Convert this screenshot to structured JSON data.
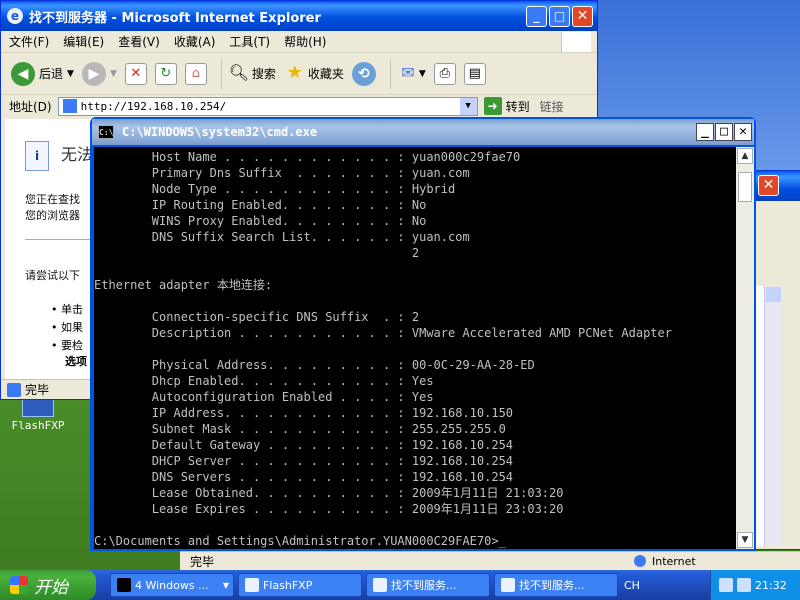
{
  "desktop": {
    "icon_label": "FlashFXP"
  },
  "ie": {
    "title": "找不到服务器 - Microsoft Internet Explorer",
    "menu": [
      "文件(F)",
      "编辑(E)",
      "查看(V)",
      "收藏(A)",
      "工具(T)",
      "帮助(H)"
    ],
    "toolbar": {
      "back": "后退",
      "search": "搜索",
      "favorites": "收藏夹"
    },
    "address_label": "地址(D)",
    "address_value": "http://192.168.10.254/",
    "go_label": "转到",
    "links_label": "链接",
    "page_title": "无法",
    "page_text1": "您正在查找",
    "page_text2": "您的浏览器",
    "page_text3": "请尝试以下",
    "bullets": [
      "单击",
      "如果",
      "要检",
      "选项"
    ],
    "status": "完毕"
  },
  "ie2": {
    "status": "完毕",
    "zone": "Internet"
  },
  "cmd": {
    "title": "C:\\WINDOWS\\system32\\cmd.exe",
    "lines": [
      "        Host Name . . . . . . . . . . . . : yuan000c29fae70",
      "        Primary Dns Suffix  . . . . . . . : yuan.com",
      "        Node Type . . . . . . . . . . . . : Hybrid",
      "        IP Routing Enabled. . . . . . . . : No",
      "        WINS Proxy Enabled. . . . . . . . : No",
      "        DNS Suffix Search List. . . . . . : yuan.com",
      "                                            2",
      "",
      "Ethernet adapter 本地连接:",
      "",
      "        Connection-specific DNS Suffix  . : 2",
      "        Description . . . . . . . . . . . : VMware Accelerated AMD PCNet Adapter",
      "",
      "        Physical Address. . . . . . . . . : 00-0C-29-AA-28-ED",
      "        Dhcp Enabled. . . . . . . . . . . : Yes",
      "        Autoconfiguration Enabled . . . . : Yes",
      "        IP Address. . . . . . . . . . . . : 192.168.10.150",
      "        Subnet Mask . . . . . . . . . . . : 255.255.255.0",
      "        Default Gateway . . . . . . . . . : 192.168.10.254",
      "        DHCP Server . . . . . . . . . . . : 192.168.10.254",
      "        DNS Servers . . . . . . . . . . . : 192.168.10.254",
      "        Lease Obtained. . . . . . . . . . : 2009年1月11日 21:03:20",
      "        Lease Expires . . . . . . . . . . : 2009年1月11日 23:03:20",
      "",
      "C:\\Documents and Settings\\Administrator.YUAN000C29FAE70>_"
    ]
  },
  "taskbar": {
    "start": "开始",
    "tasks": [
      "4 Windows ...",
      "FlashFXP",
      "找不到服务...",
      "找不到服务..."
    ],
    "lang": "CH",
    "time": "21:32"
  }
}
